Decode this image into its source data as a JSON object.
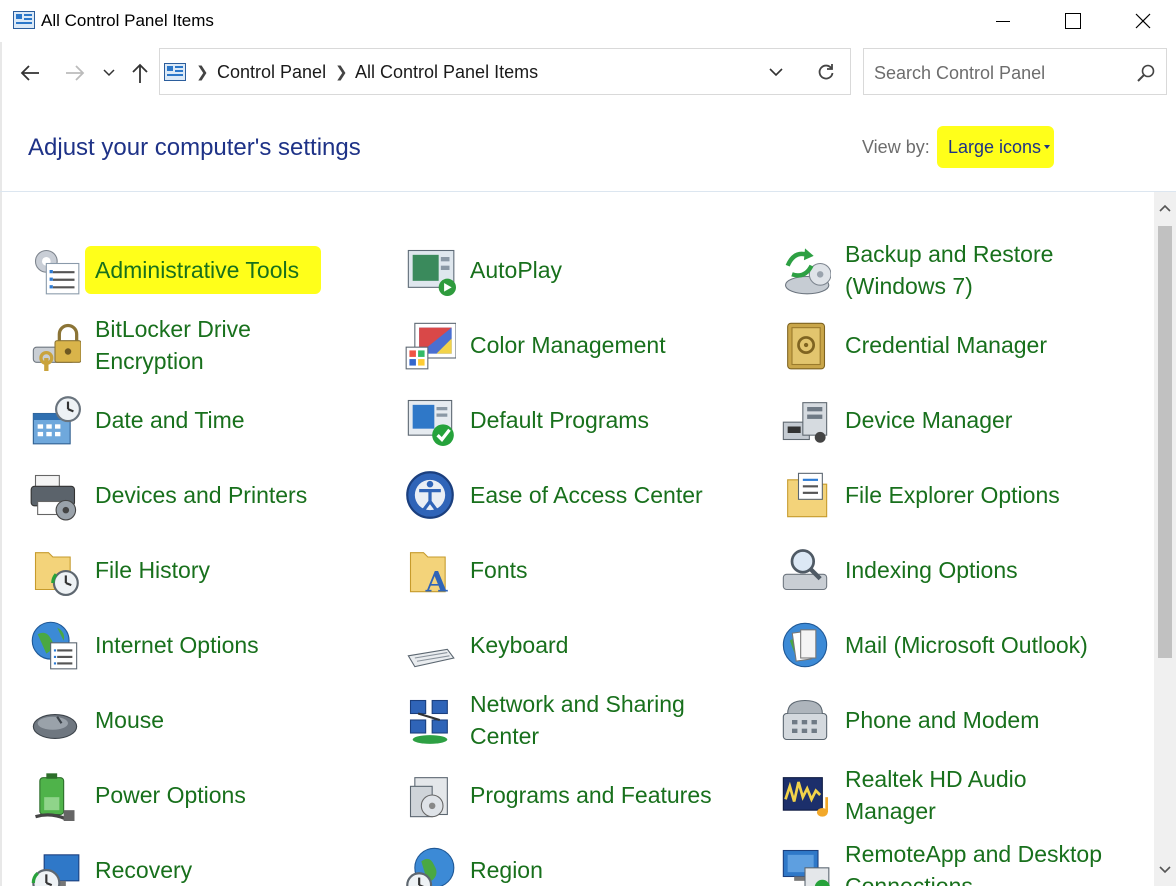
{
  "window": {
    "title": "All Control Panel Items"
  },
  "address": {
    "crumbs": [
      "Control Panel",
      "All Control Panel Items"
    ]
  },
  "search": {
    "placeholder": "Search Control Panel"
  },
  "header": {
    "title": "Adjust your computer's settings",
    "view_by_label": "View by:",
    "view_by_value": "Large icons"
  },
  "items": [
    {
      "label": "Administrative Tools",
      "icon": "admin-tools-icon",
      "highlighted": true
    },
    {
      "label": "AutoPlay",
      "icon": "autoplay-icon"
    },
    {
      "label": "Backup and Restore\n(Windows 7)",
      "icon": "backup-restore-icon"
    },
    {
      "label": "BitLocker Drive\nEncryption",
      "icon": "bitlocker-icon"
    },
    {
      "label": "Color Management",
      "icon": "color-management-icon"
    },
    {
      "label": "Credential Manager",
      "icon": "credential-manager-icon"
    },
    {
      "label": "Date and Time",
      "icon": "date-time-icon"
    },
    {
      "label": "Default Programs",
      "icon": "default-programs-icon"
    },
    {
      "label": "Device Manager",
      "icon": "device-manager-icon"
    },
    {
      "label": "Devices and Printers",
      "icon": "devices-printers-icon"
    },
    {
      "label": "Ease of Access Center",
      "icon": "ease-of-access-icon"
    },
    {
      "label": "File Explorer Options",
      "icon": "file-explorer-options-icon"
    },
    {
      "label": "File History",
      "icon": "file-history-icon"
    },
    {
      "label": "Fonts",
      "icon": "fonts-icon"
    },
    {
      "label": "Indexing Options",
      "icon": "indexing-options-icon"
    },
    {
      "label": "Internet Options",
      "icon": "internet-options-icon"
    },
    {
      "label": "Keyboard",
      "icon": "keyboard-icon"
    },
    {
      "label": "Mail (Microsoft Outlook)",
      "icon": "mail-icon"
    },
    {
      "label": "Mouse",
      "icon": "mouse-icon"
    },
    {
      "label": "Network and Sharing\nCenter",
      "icon": "network-sharing-icon"
    },
    {
      "label": "Phone and Modem",
      "icon": "phone-modem-icon"
    },
    {
      "label": "Power Options",
      "icon": "power-options-icon"
    },
    {
      "label": "Programs and Features",
      "icon": "programs-features-icon"
    },
    {
      "label": "Realtek HD Audio\nManager",
      "icon": "realtek-audio-icon"
    },
    {
      "label": "Recovery",
      "icon": "recovery-icon"
    },
    {
      "label": "Region",
      "icon": "region-icon"
    },
    {
      "label": "RemoteApp and Desktop\nConnections",
      "icon": "remoteapp-icon"
    }
  ],
  "colors": {
    "link_green": "#18701c",
    "header_blue": "#1e3287",
    "highlight_yellow": "#ffff1a"
  }
}
